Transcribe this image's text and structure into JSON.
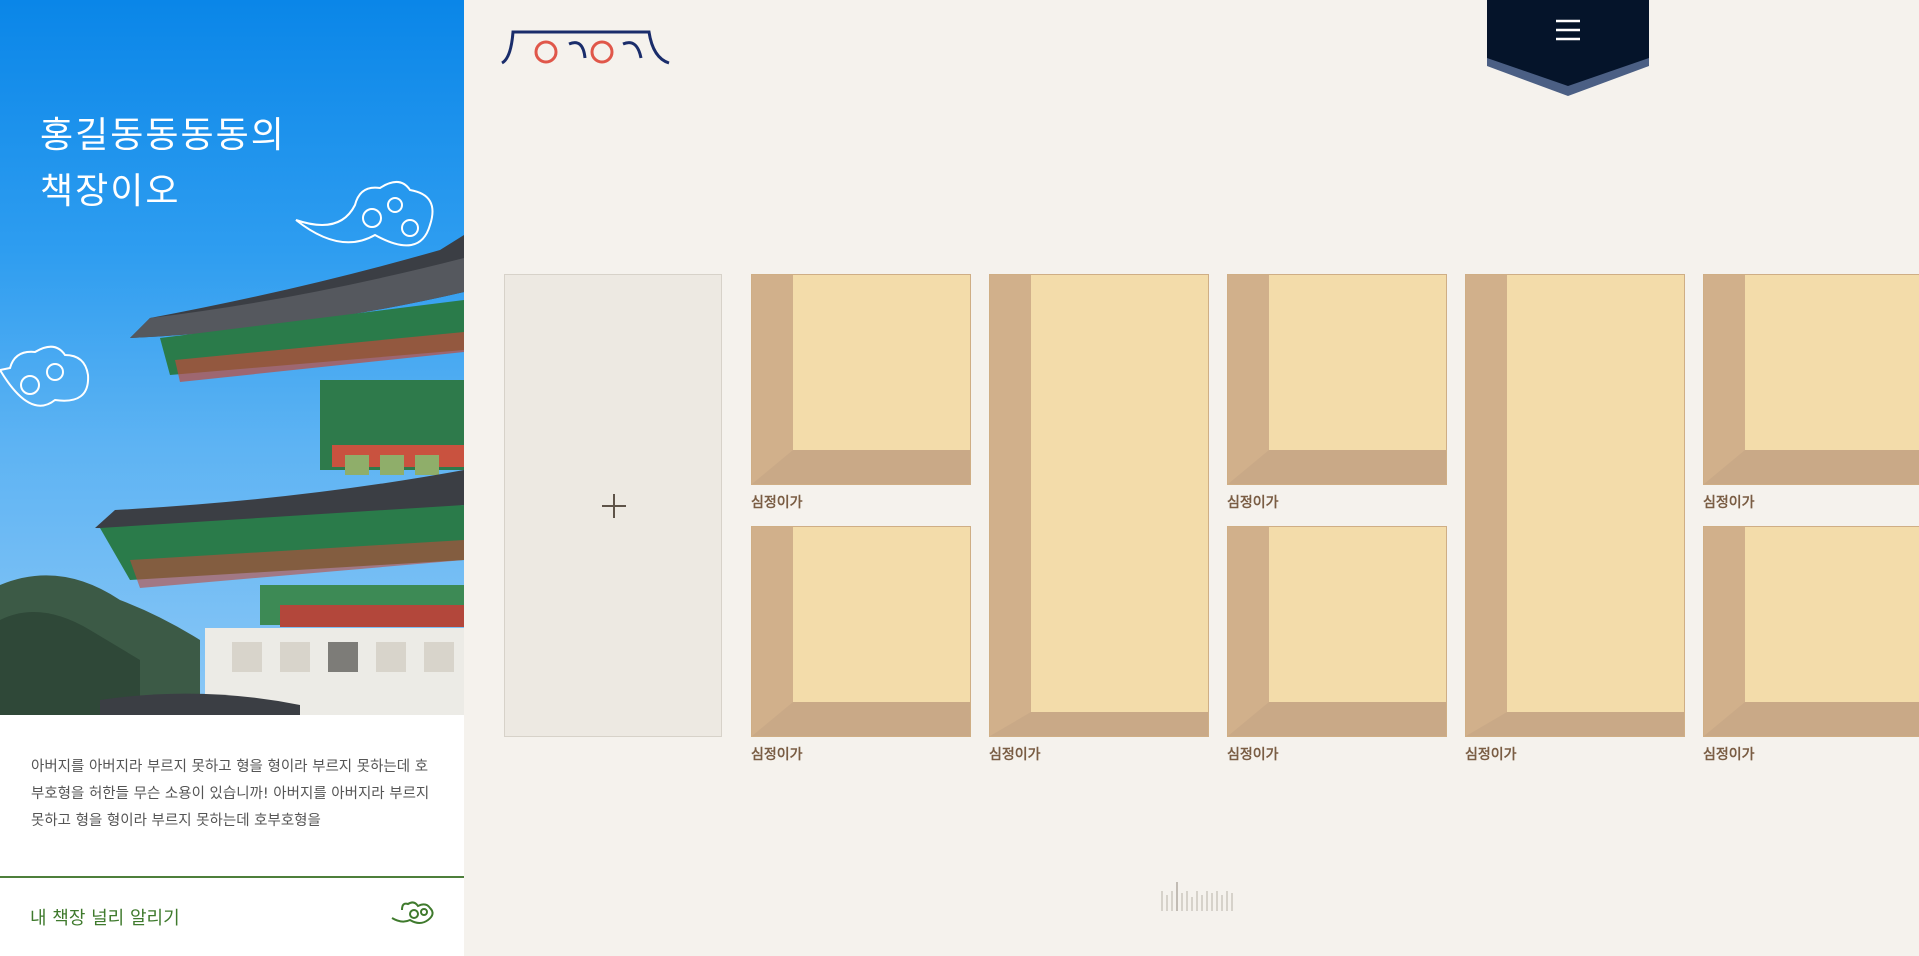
{
  "sidebar": {
    "title_line1": "홍길동동동동의",
    "title_line2": "책장이오",
    "description": "아버지를 아버지라 부르지 못하고 형을 형이라 부르지 못하는데 호부호형을 허한들 무슨 소용이 있습니까! 아버지를 아버지라 부르지 못하고 형을 형이라 부르지 못하는데 호부호형을",
    "share_label": "내 책장 널리 알리기"
  },
  "header": {
    "logo_icon": "hanok-roof-logo-icon",
    "menu_icon": "hamburger-menu-icon"
  },
  "shelf": {
    "add_icon": "plus-icon",
    "books": [
      {
        "label": "심정이가"
      },
      {
        "label": "심정이가"
      },
      {
        "label": "심정이가"
      },
      {
        "label": "심정이가"
      },
      {
        "label": "심정이가"
      },
      {
        "label": "심정이가"
      },
      {
        "label": "심정이가"
      },
      {
        "label": "심정이가"
      },
      {
        "label": "심정이가"
      }
    ]
  },
  "colors": {
    "sky": "#0a86e8",
    "menu_bg": "#05142a",
    "menu_ribbon": "#4b5f84",
    "book_face": "#f3dcaa",
    "book_side": "#d1b08b",
    "share_green": "#3f7a2d"
  }
}
